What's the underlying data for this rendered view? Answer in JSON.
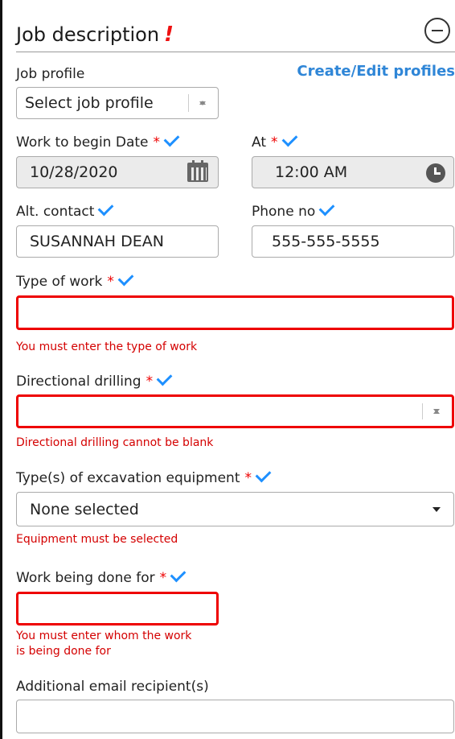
{
  "section": {
    "title": "Job description",
    "alert_glyph": "!",
    "collapse_glyph": "−"
  },
  "job_profile": {
    "label": "Job profile",
    "link": "Create/Edit profiles",
    "selected": "Select job profile"
  },
  "begin_date": {
    "label": "Work to begin Date",
    "value": "10/28/2020"
  },
  "begin_time": {
    "label": "At",
    "value": "12:00 AM"
  },
  "alt_contact": {
    "label": "Alt. contact",
    "value": "SUSANNAH DEAN"
  },
  "phone": {
    "label": "Phone no",
    "value": "555-555-5555"
  },
  "type_of_work": {
    "label": "Type of work",
    "value": "",
    "error": "You must enter the type of work"
  },
  "directional_drilling": {
    "label": "Directional drilling",
    "value": "",
    "error": "Directional drilling cannot be blank"
  },
  "equipment": {
    "label": "Type(s) of excavation equipment",
    "selected": "None selected",
    "error": "Equipment must be selected"
  },
  "work_done_for": {
    "label": "Work being done for",
    "value": "",
    "error_line1": "You must enter whom the work",
    "error_line2": "is being done for"
  },
  "additional_email": {
    "label": "Additional email recipient(s)",
    "value": ""
  },
  "required_marker": "*",
  "colors": {
    "error": "#e00000",
    "link": "#2f86d7",
    "check": "#1e90ff",
    "disabled_bg": "#ebebeb"
  }
}
